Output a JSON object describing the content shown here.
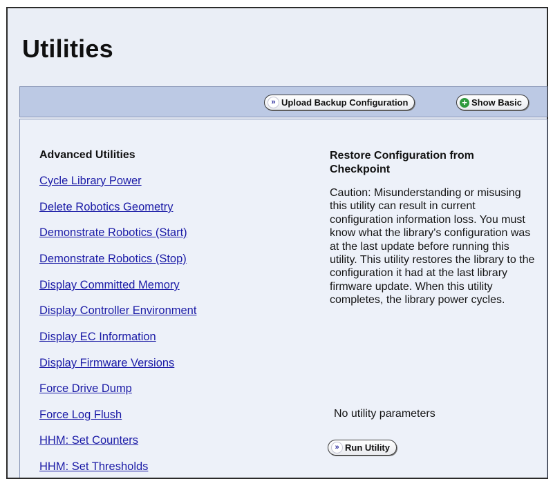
{
  "page": {
    "title": "Utilities"
  },
  "toolbar": {
    "upload_label": "Upload Backup Configuration",
    "show_basic_label": "Show Basic"
  },
  "left": {
    "heading": "Advanced Utilities",
    "links": [
      "Cycle Library Power",
      "Delete Robotics Geometry",
      "Demonstrate Robotics (Start)",
      "Demonstrate Robotics (Stop)",
      "Display Committed Memory",
      "Display Controller Environment",
      "Display EC Information",
      "Display Firmware Versions",
      "Force Drive Dump",
      "Force Log Flush",
      "HHM: Set Counters",
      "HHM: Set Thresholds"
    ]
  },
  "right": {
    "title": "Restore Configuration from Checkpoint",
    "caution": "Caution: Misunderstanding or misusing this utility can result in current configuration information loss. You must know what the library's configuration was at the last update before running this utility. This utility restores the library to the configuration it had at the last library firmware update. When this utility completes, the library power cycles.",
    "no_params": "No utility parameters",
    "run_label": "Run Utility"
  },
  "icons": {
    "double_chevron": "»",
    "plus": "+"
  },
  "colors": {
    "link": "#1a1aa6",
    "toolbar_bg": "#bcc9e4",
    "panel_bg": "#edf1f9",
    "plus_icon": "#2e9a3e"
  }
}
